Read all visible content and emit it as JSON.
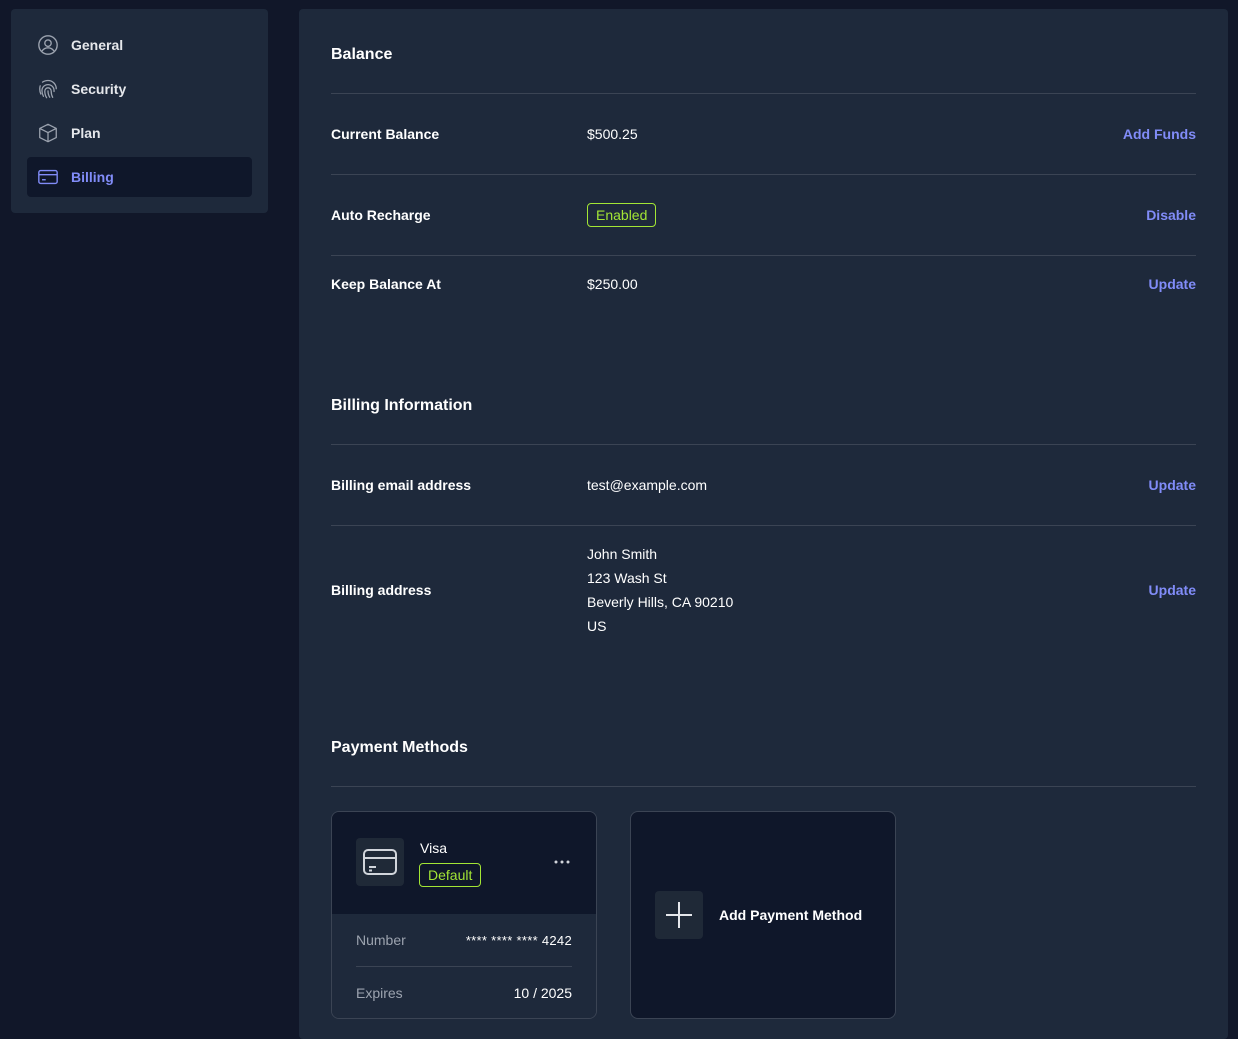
{
  "sidebar": {
    "items": [
      {
        "label": "General",
        "icon": "user-circle-icon"
      },
      {
        "label": "Security",
        "icon": "fingerprint-icon"
      },
      {
        "label": "Plan",
        "icon": "cube-icon"
      },
      {
        "label": "Billing",
        "icon": "credit-card-icon",
        "active": true
      }
    ]
  },
  "balance": {
    "title": "Balance",
    "rows": [
      {
        "label": "Current Balance",
        "value": "$500.25",
        "action": "Add Funds"
      },
      {
        "label": "Auto Recharge",
        "value": "Enabled",
        "action": "Disable"
      },
      {
        "label": "Keep Balance At",
        "value": "$250.00",
        "action": "Update"
      }
    ]
  },
  "billing_info": {
    "title": "Billing Information",
    "email": {
      "label": "Billing email address",
      "value": "test@example.com",
      "action": "Update"
    },
    "address": {
      "label": "Billing address",
      "lines": [
        "John Smith",
        "123 Wash St",
        "Beverly Hills, CA 90210",
        "US"
      ],
      "action": "Update"
    }
  },
  "payment_methods": {
    "title": "Payment Methods",
    "card": {
      "brand": "Visa",
      "badge": "Default",
      "number_label": "Number",
      "number_value": "**** **** **** 4242",
      "expires_label": "Expires",
      "expires_value": "10 / 2025",
      "menu_icon": "ellipsis-icon"
    },
    "add_label": "Add Payment Method"
  },
  "colors": {
    "accent": "#818cf8",
    "success": "#a3e635",
    "panel": "#1e293b",
    "background": "#111729"
  }
}
